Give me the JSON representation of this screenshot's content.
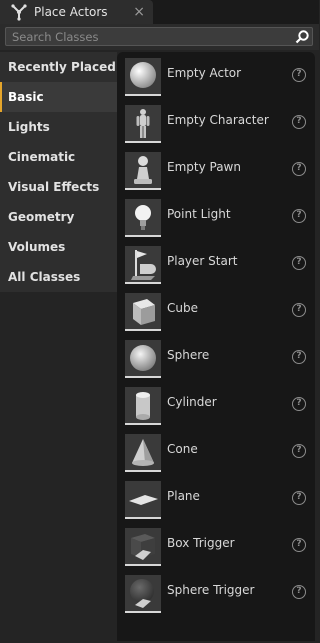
{
  "window": {
    "tab_title": "Place Actors",
    "close_glyph": "×"
  },
  "search": {
    "placeholder": "Search Classes",
    "value": ""
  },
  "sidebar": {
    "items": [
      {
        "label": "Recently Placed",
        "active": false
      },
      {
        "label": "Basic",
        "active": true
      },
      {
        "label": "Lights",
        "active": false
      },
      {
        "label": "Cinematic",
        "active": false
      },
      {
        "label": "Visual Effects",
        "active": false
      },
      {
        "label": "Geometry",
        "active": false
      },
      {
        "label": "Volumes",
        "active": false
      },
      {
        "label": "All Classes",
        "active": false
      }
    ]
  },
  "actors": [
    {
      "label": "Empty Actor",
      "icon": "empty-actor-icon"
    },
    {
      "label": "Empty Character",
      "icon": "character-icon"
    },
    {
      "label": "Empty Pawn",
      "icon": "pawn-icon"
    },
    {
      "label": "Point Light",
      "icon": "light-bulb-icon"
    },
    {
      "label": "Player Start",
      "icon": "player-start-icon"
    },
    {
      "label": "Cube",
      "icon": "cube-icon"
    },
    {
      "label": "Sphere",
      "icon": "sphere-icon"
    },
    {
      "label": "Cylinder",
      "icon": "cylinder-icon"
    },
    {
      "label": "Cone",
      "icon": "cone-icon"
    },
    {
      "label": "Plane",
      "icon": "plane-icon"
    },
    {
      "label": "Box Trigger",
      "icon": "box-trigger-icon"
    },
    {
      "label": "Sphere Trigger",
      "icon": "sphere-trigger-icon"
    }
  ],
  "help_glyph": "?",
  "colors": {
    "accent": "#e5a52b",
    "panel": "#171717",
    "sidebar": "#2e2e2e"
  }
}
